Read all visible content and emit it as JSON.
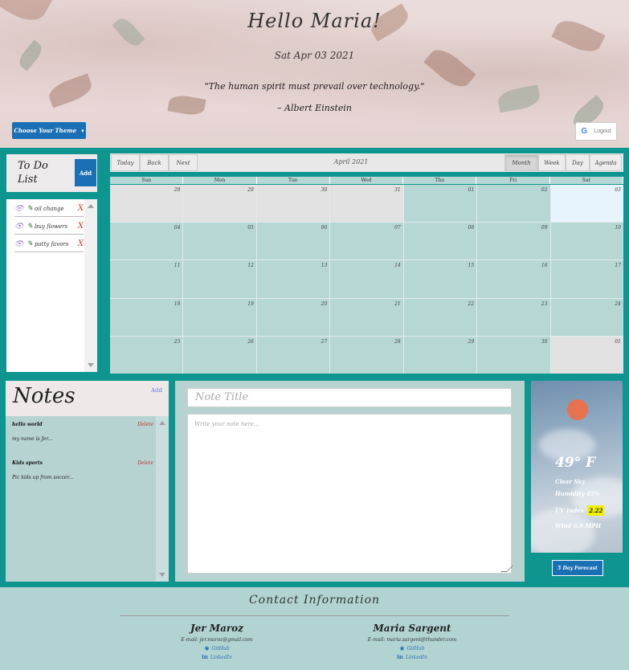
{
  "header": {
    "greeting": "Hello Maria!",
    "date": "Sat Apr 03 2021",
    "quote": "\"The human spirit must prevail over technology.\"",
    "author": "– Albert Einstein",
    "theme_button": "Choose Your Theme",
    "logout_button": "Logout",
    "google_icon": "G"
  },
  "todo": {
    "title": "To Do List",
    "add_label": "Add",
    "items": [
      {
        "text": "oil change",
        "delete": "X"
      },
      {
        "text": "buy flowers",
        "delete": "X"
      },
      {
        "text": "patty favors",
        "delete": "X"
      }
    ]
  },
  "calendar": {
    "buttons": {
      "today": "Today",
      "back": "Back",
      "next": "Next",
      "month": "Month",
      "week": "Week",
      "day": "Day",
      "agenda": "Agenda"
    },
    "label": "April 2021",
    "days_of_week": [
      "Sun",
      "Mon",
      "Tue",
      "Wed",
      "Thu",
      "Fri",
      "Sat"
    ],
    "weeks": [
      [
        "28",
        "29",
        "30",
        "31",
        "01",
        "02",
        "03"
      ],
      [
        "04",
        "05",
        "06",
        "07",
        "08",
        "09",
        "10"
      ],
      [
        "11",
        "12",
        "13",
        "14",
        "15",
        "16",
        "17"
      ],
      [
        "18",
        "19",
        "20",
        "21",
        "22",
        "23",
        "24"
      ],
      [
        "25",
        "26",
        "27",
        "28",
        "29",
        "30",
        "01"
      ]
    ]
  },
  "notes": {
    "title": "Notes",
    "add_label": "Add",
    "items": [
      {
        "title": "hello world",
        "body": "my name is Jer...",
        "delete": "Delete"
      },
      {
        "title": "Kids sports",
        "body": "Pic kids up from soccer...",
        "delete": "Delete"
      }
    ]
  },
  "editor": {
    "title_placeholder": "Note Title",
    "body_placeholder": "Write your note here..."
  },
  "weather": {
    "temp": "49° F",
    "condition": "Clear Sky",
    "humidity": "Humidity 45%",
    "uv_label": "UV Index",
    "uv_value": "2.22",
    "wind": "Wind 6.9 MPH",
    "forecast_button": "5 Day Forecast",
    "colors": {
      "sun": "#e8714f",
      "uv_badge": "#f0f000"
    }
  },
  "footer": {
    "title": "Contact Information",
    "people": [
      {
        "name": "Jer Maroz",
        "email": "E-mail: jer.maroz@gmail.com",
        "github": "GitHub",
        "linkedin": "LinkedIn"
      },
      {
        "name": "Maria Sargent",
        "email": "E-mail: maria.sargent@thunder.com",
        "github": "GitHub",
        "linkedin": "LinkedIn"
      }
    ]
  },
  "colors": {
    "accent": "#1a6fb5",
    "background": "#0e9590",
    "calendar_cell": "#b6d7d4",
    "footer": "#b1d4d2"
  }
}
